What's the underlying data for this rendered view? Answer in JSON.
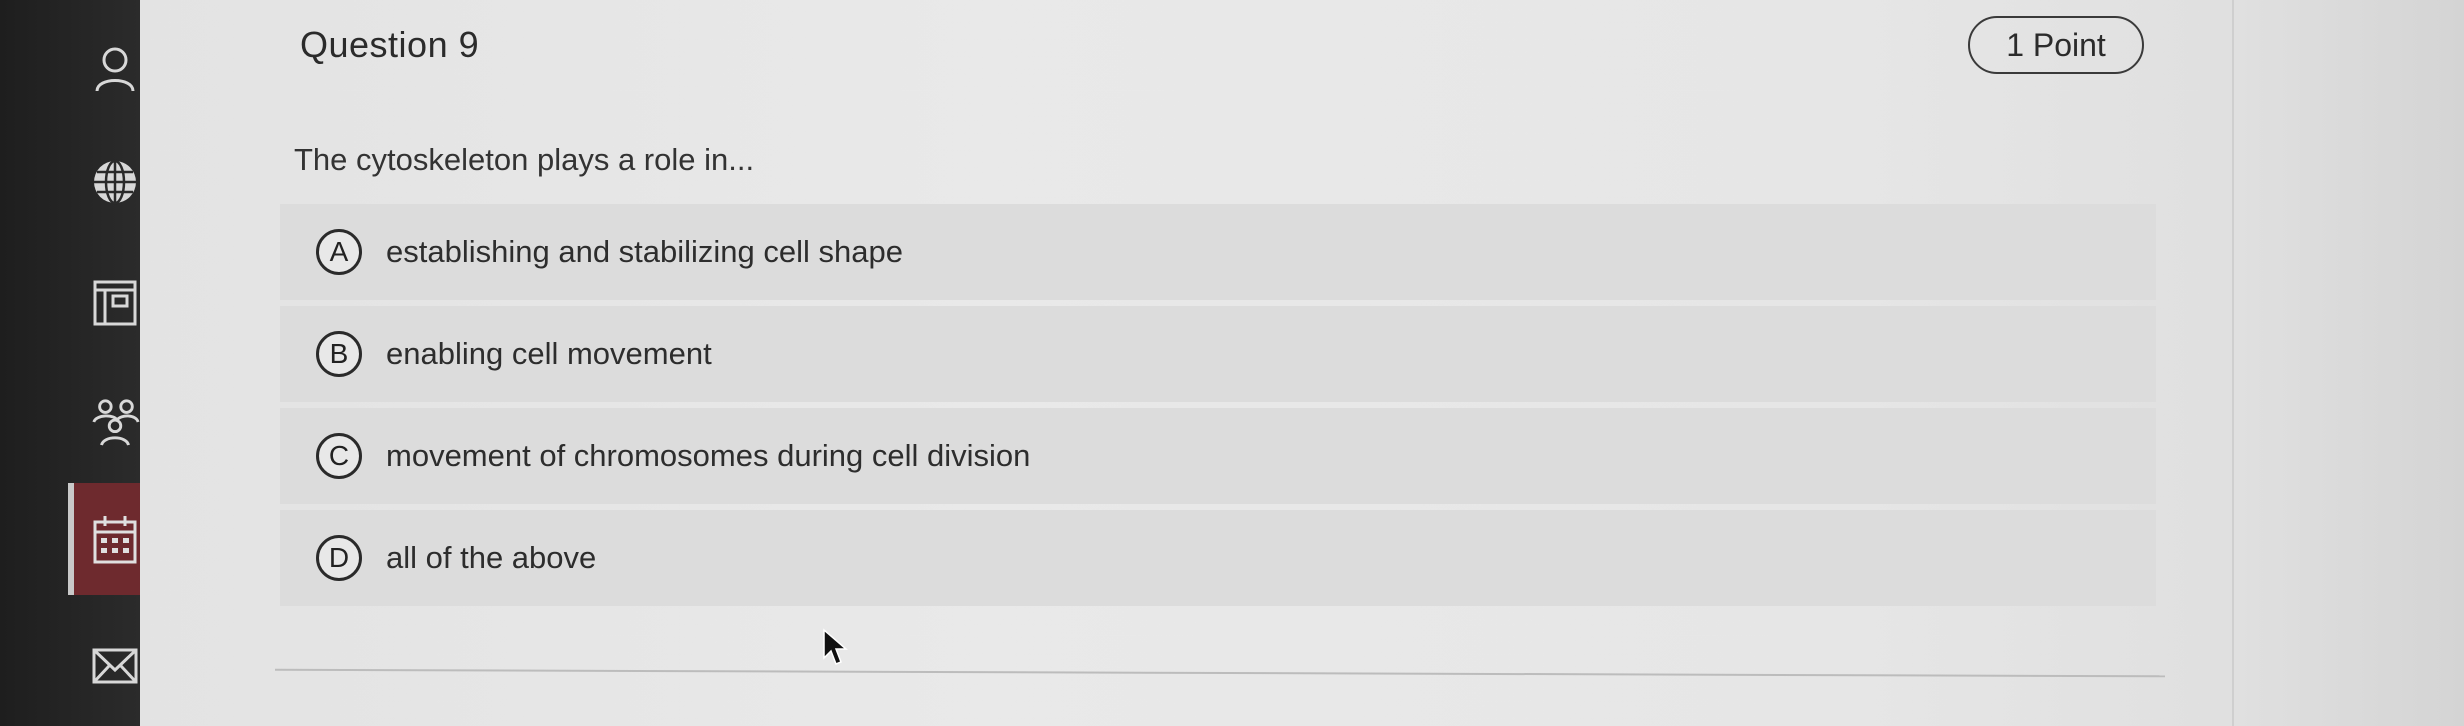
{
  "sidebar": {
    "items": [
      {
        "icon": "profile-icon"
      },
      {
        "icon": "globe-icon"
      },
      {
        "icon": "courses-icon"
      },
      {
        "icon": "groups-icon"
      },
      {
        "icon": "calendar-icon",
        "active": true
      },
      {
        "icon": "messages-icon"
      }
    ],
    "active_color": "#6e2a2e"
  },
  "question": {
    "title": "Question 9",
    "points": "1 Point",
    "prompt": "The cytoskeleton plays a role in..."
  },
  "options": [
    {
      "letter": "A",
      "text": "establishing and stabilizing cell shape"
    },
    {
      "letter": "B",
      "text": "enabling cell movement"
    },
    {
      "letter": "C",
      "text": "movement of chromosomes during cell division"
    },
    {
      "letter": "D",
      "text": "all of the above"
    }
  ]
}
